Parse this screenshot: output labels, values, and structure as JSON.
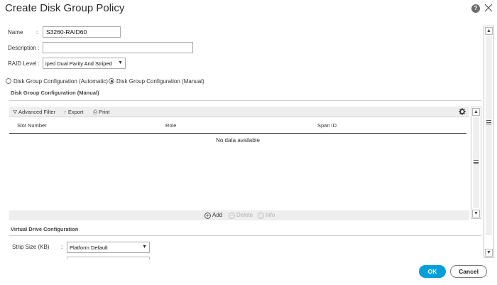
{
  "dialog": {
    "title": "Create Disk Group Policy",
    "help_label": "?"
  },
  "form": {
    "name_label": "Name",
    "name_colon": ":",
    "name_value": "S3260-RAID60",
    "description_label": "Description :",
    "description_value": "",
    "raid_label": "RAID Level :",
    "raid_value": "iped Dual Parity And Striped",
    "radio_automatic": "Disk Group Configuration (Automatic)",
    "radio_manual": "Disk Group Configuration (Manual)",
    "selected_radio": "manual"
  },
  "manual_section": {
    "title": "Disk Group Configuration (Manual)",
    "toolbar": {
      "advanced_filter": "Advanced Filter",
      "export": "Export",
      "print": "Print"
    },
    "columns": [
      "Slot Number",
      "Role",
      "Span ID"
    ],
    "empty_text": "No data available",
    "actions": {
      "add": "Add",
      "delete": "Delete",
      "info": "Info"
    }
  },
  "virtual_drive": {
    "title": "Virtual Drive Configuration",
    "strip_size_label": "Strip Size (KB)",
    "strip_size_colon": ":",
    "strip_size_value": "Platform Default"
  },
  "buttons": {
    "ok": "OK",
    "cancel": "Cancel"
  },
  "colors": {
    "primary": "#049fd9",
    "toolbar_bg": "#eeeeee",
    "add_icon": "#555555",
    "disabled": "#b0b0b0"
  },
  "icons": [
    "help-icon",
    "close-icon",
    "filter-icon",
    "export-icon",
    "print-icon",
    "gear-icon",
    "add-icon",
    "delete-icon",
    "info-icon",
    "chevron-down-icon",
    "scroll-grip-icon"
  ]
}
